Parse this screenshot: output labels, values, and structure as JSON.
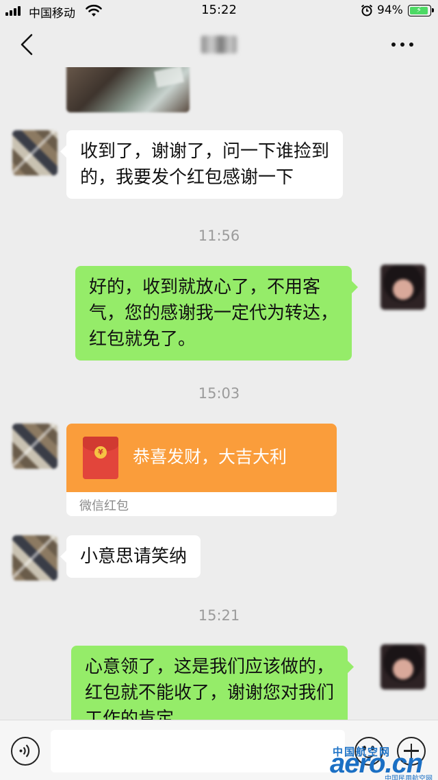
{
  "status_bar": {
    "carrier": "中国移动",
    "time": "15:22",
    "battery_pct": "94%",
    "battery_level": 0.94
  },
  "nav": {
    "title_blurred": true
  },
  "messages": [
    {
      "type": "text",
      "side": "in",
      "text_lines": [
        "收到了，谢谢了，问一下谁捡到",
        "的，我要发个红包感谢一下"
      ]
    },
    {
      "type": "timestamp",
      "text": "11:56"
    },
    {
      "type": "text",
      "side": "out",
      "text_lines": [
        "好的，收到就放心了，不用客",
        "气，您的感谢我一定代为转达，",
        "红包就免了。"
      ]
    },
    {
      "type": "timestamp",
      "text": "15:03"
    },
    {
      "type": "red_packet",
      "side": "in",
      "greeting": "恭喜发财，大吉大利",
      "label": "微信红包"
    },
    {
      "type": "text",
      "side": "in",
      "text_lines": [
        "小意思请笑纳"
      ]
    },
    {
      "type": "timestamp",
      "text": "15:21"
    },
    {
      "type": "text",
      "side": "out",
      "text_lines": [
        "心意领了，这是我们应该做的，",
        "红包就不能收了，谢谢您对我们",
        "工作的肯定。"
      ]
    }
  ],
  "watermark": {
    "cn": "中国航空网",
    "main": "aero.cn",
    "sub": "中国民用航空网"
  },
  "colors": {
    "background": "#ededed",
    "bubble_out": "#95ec69",
    "bubble_in": "#ffffff",
    "red_packet": "#fa9d3b",
    "watermark": "#1a6fc4"
  }
}
